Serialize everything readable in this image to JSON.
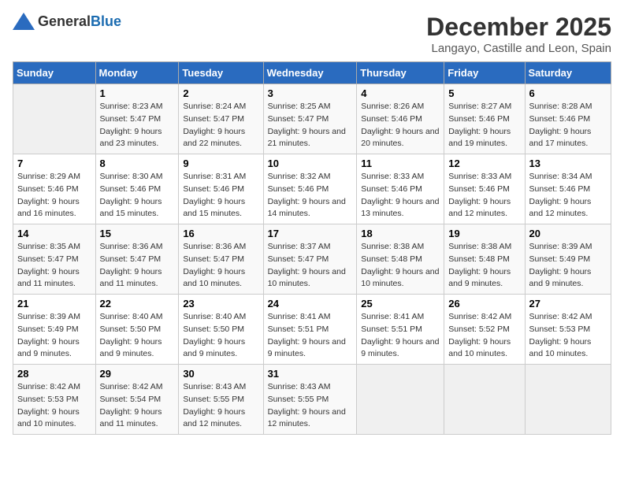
{
  "logo": {
    "text_general": "General",
    "text_blue": "Blue"
  },
  "title": "December 2025",
  "subtitle": "Langayo, Castille and Leon, Spain",
  "header_days": [
    "Sunday",
    "Monday",
    "Tuesday",
    "Wednesday",
    "Thursday",
    "Friday",
    "Saturday"
  ],
  "weeks": [
    [
      {
        "day": "",
        "empty": true
      },
      {
        "day": "1",
        "sunrise": "Sunrise: 8:23 AM",
        "sunset": "Sunset: 5:47 PM",
        "daylight": "Daylight: 9 hours and 23 minutes."
      },
      {
        "day": "2",
        "sunrise": "Sunrise: 8:24 AM",
        "sunset": "Sunset: 5:47 PM",
        "daylight": "Daylight: 9 hours and 22 minutes."
      },
      {
        "day": "3",
        "sunrise": "Sunrise: 8:25 AM",
        "sunset": "Sunset: 5:47 PM",
        "daylight": "Daylight: 9 hours and 21 minutes."
      },
      {
        "day": "4",
        "sunrise": "Sunrise: 8:26 AM",
        "sunset": "Sunset: 5:46 PM",
        "daylight": "Daylight: 9 hours and 20 minutes."
      },
      {
        "day": "5",
        "sunrise": "Sunrise: 8:27 AM",
        "sunset": "Sunset: 5:46 PM",
        "daylight": "Daylight: 9 hours and 19 minutes."
      },
      {
        "day": "6",
        "sunrise": "Sunrise: 8:28 AM",
        "sunset": "Sunset: 5:46 PM",
        "daylight": "Daylight: 9 hours and 17 minutes."
      }
    ],
    [
      {
        "day": "7",
        "sunrise": "Sunrise: 8:29 AM",
        "sunset": "Sunset: 5:46 PM",
        "daylight": "Daylight: 9 hours and 16 minutes."
      },
      {
        "day": "8",
        "sunrise": "Sunrise: 8:30 AM",
        "sunset": "Sunset: 5:46 PM",
        "daylight": "Daylight: 9 hours and 15 minutes."
      },
      {
        "day": "9",
        "sunrise": "Sunrise: 8:31 AM",
        "sunset": "Sunset: 5:46 PM",
        "daylight": "Daylight: 9 hours and 15 minutes."
      },
      {
        "day": "10",
        "sunrise": "Sunrise: 8:32 AM",
        "sunset": "Sunset: 5:46 PM",
        "daylight": "Daylight: 9 hours and 14 minutes."
      },
      {
        "day": "11",
        "sunrise": "Sunrise: 8:33 AM",
        "sunset": "Sunset: 5:46 PM",
        "daylight": "Daylight: 9 hours and 13 minutes."
      },
      {
        "day": "12",
        "sunrise": "Sunrise: 8:33 AM",
        "sunset": "Sunset: 5:46 PM",
        "daylight": "Daylight: 9 hours and 12 minutes."
      },
      {
        "day": "13",
        "sunrise": "Sunrise: 8:34 AM",
        "sunset": "Sunset: 5:46 PM",
        "daylight": "Daylight: 9 hours and 12 minutes."
      }
    ],
    [
      {
        "day": "14",
        "sunrise": "Sunrise: 8:35 AM",
        "sunset": "Sunset: 5:47 PM",
        "daylight": "Daylight: 9 hours and 11 minutes."
      },
      {
        "day": "15",
        "sunrise": "Sunrise: 8:36 AM",
        "sunset": "Sunset: 5:47 PM",
        "daylight": "Daylight: 9 hours and 11 minutes."
      },
      {
        "day": "16",
        "sunrise": "Sunrise: 8:36 AM",
        "sunset": "Sunset: 5:47 PM",
        "daylight": "Daylight: 9 hours and 10 minutes."
      },
      {
        "day": "17",
        "sunrise": "Sunrise: 8:37 AM",
        "sunset": "Sunset: 5:47 PM",
        "daylight": "Daylight: 9 hours and 10 minutes."
      },
      {
        "day": "18",
        "sunrise": "Sunrise: 8:38 AM",
        "sunset": "Sunset: 5:48 PM",
        "daylight": "Daylight: 9 hours and 10 minutes."
      },
      {
        "day": "19",
        "sunrise": "Sunrise: 8:38 AM",
        "sunset": "Sunset: 5:48 PM",
        "daylight": "Daylight: 9 hours and 9 minutes."
      },
      {
        "day": "20",
        "sunrise": "Sunrise: 8:39 AM",
        "sunset": "Sunset: 5:49 PM",
        "daylight": "Daylight: 9 hours and 9 minutes."
      }
    ],
    [
      {
        "day": "21",
        "sunrise": "Sunrise: 8:39 AM",
        "sunset": "Sunset: 5:49 PM",
        "daylight": "Daylight: 9 hours and 9 minutes."
      },
      {
        "day": "22",
        "sunrise": "Sunrise: 8:40 AM",
        "sunset": "Sunset: 5:50 PM",
        "daylight": "Daylight: 9 hours and 9 minutes."
      },
      {
        "day": "23",
        "sunrise": "Sunrise: 8:40 AM",
        "sunset": "Sunset: 5:50 PM",
        "daylight": "Daylight: 9 hours and 9 minutes."
      },
      {
        "day": "24",
        "sunrise": "Sunrise: 8:41 AM",
        "sunset": "Sunset: 5:51 PM",
        "daylight": "Daylight: 9 hours and 9 minutes."
      },
      {
        "day": "25",
        "sunrise": "Sunrise: 8:41 AM",
        "sunset": "Sunset: 5:51 PM",
        "daylight": "Daylight: 9 hours and 9 minutes."
      },
      {
        "day": "26",
        "sunrise": "Sunrise: 8:42 AM",
        "sunset": "Sunset: 5:52 PM",
        "daylight": "Daylight: 9 hours and 10 minutes."
      },
      {
        "day": "27",
        "sunrise": "Sunrise: 8:42 AM",
        "sunset": "Sunset: 5:53 PM",
        "daylight": "Daylight: 9 hours and 10 minutes."
      }
    ],
    [
      {
        "day": "28",
        "sunrise": "Sunrise: 8:42 AM",
        "sunset": "Sunset: 5:53 PM",
        "daylight": "Daylight: 9 hours and 10 minutes."
      },
      {
        "day": "29",
        "sunrise": "Sunrise: 8:42 AM",
        "sunset": "Sunset: 5:54 PM",
        "daylight": "Daylight: 9 hours and 11 minutes."
      },
      {
        "day": "30",
        "sunrise": "Sunrise: 8:43 AM",
        "sunset": "Sunset: 5:55 PM",
        "daylight": "Daylight: 9 hours and 12 minutes."
      },
      {
        "day": "31",
        "sunrise": "Sunrise: 8:43 AM",
        "sunset": "Sunset: 5:55 PM",
        "daylight": "Daylight: 9 hours and 12 minutes."
      },
      {
        "day": "",
        "empty": true
      },
      {
        "day": "",
        "empty": true
      },
      {
        "day": "",
        "empty": true
      }
    ]
  ]
}
